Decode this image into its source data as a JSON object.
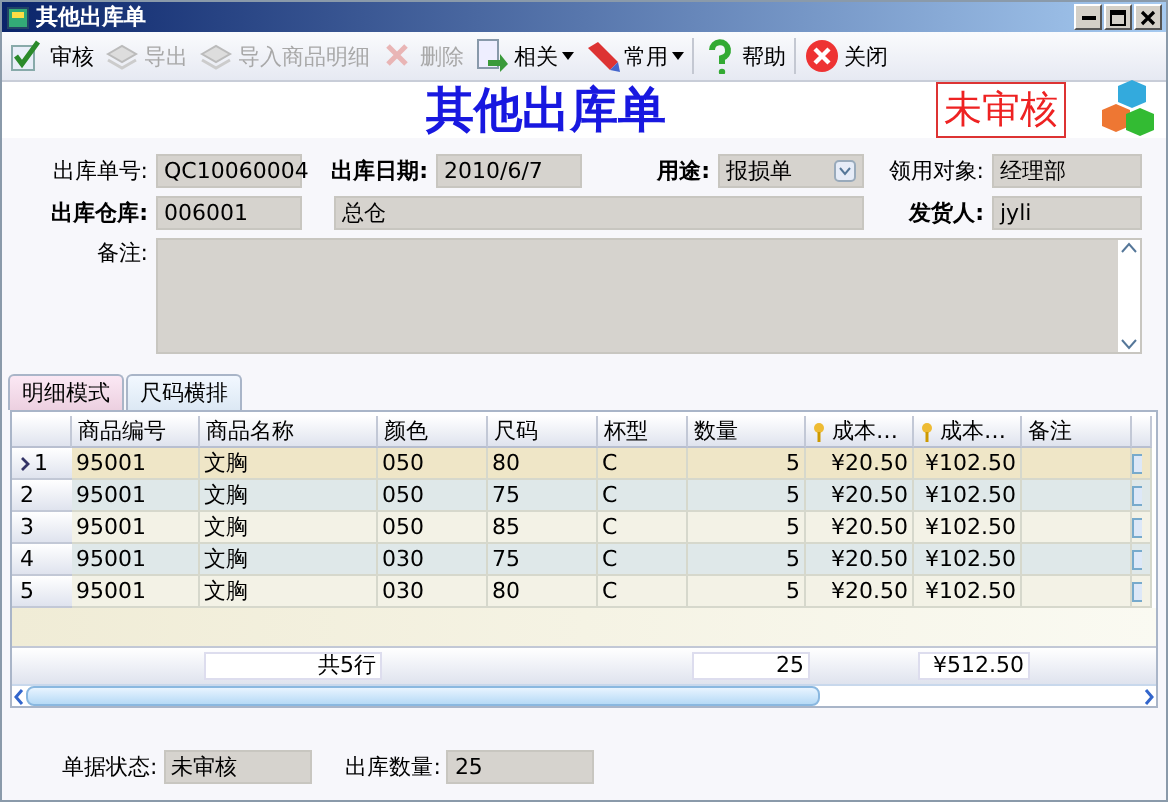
{
  "window": {
    "title": "其他出库单"
  },
  "toolbar": [
    {
      "label": "审核",
      "disabled": false,
      "dropdown": false
    },
    {
      "label": "导出",
      "disabled": true,
      "dropdown": false
    },
    {
      "label": "导入商品明细",
      "disabled": true,
      "dropdown": false
    },
    {
      "label": "删除",
      "disabled": true,
      "dropdown": false
    },
    {
      "label": "相关",
      "disabled": false,
      "dropdown": true
    },
    {
      "label": "常用",
      "disabled": false,
      "dropdown": true
    },
    {
      "label": "帮助",
      "disabled": false,
      "dropdown": false
    },
    {
      "label": "关闭",
      "disabled": false,
      "dropdown": false
    }
  ],
  "heading": "其他出库单",
  "status_stamp": "未审核",
  "form": [
    {
      "label": "出库单号:",
      "value": "QC10060004",
      "required": false
    },
    {
      "label": "出库日期:",
      "value": "2010/6/7",
      "required": true
    },
    {
      "label": "用途:",
      "value": "报损单",
      "required": true,
      "kind": "select"
    },
    {
      "label": "领用对象:",
      "value": "经理部",
      "required": false
    },
    {
      "label": "出库仓库:",
      "value": "006001",
      "required": true,
      "extra": "总仓"
    },
    {
      "label": "发货人:",
      "value": "jyli",
      "required": true
    }
  ],
  "notes": {
    "label": "备注:"
  },
  "tabs": [
    {
      "label": "明细模式",
      "selected": true
    },
    {
      "label": "尺码横排",
      "selected": false
    }
  ],
  "table": {
    "columns": [
      "商品编号",
      "商品名称",
      "颜色",
      "尺码",
      "杯型",
      "数量",
      "成本…",
      "成本…",
      "备注"
    ],
    "rows": [
      {
        "index": "1",
        "selected": true,
        "cells": [
          "95001",
          "文胸",
          "050",
          "80",
          "C",
          "5",
          "¥20.50",
          "¥102.50",
          ""
        ]
      },
      {
        "index": "2",
        "selected": false,
        "cells": [
          "95001",
          "文胸",
          "050",
          "75",
          "C",
          "5",
          "¥20.50",
          "¥102.50",
          ""
        ]
      },
      {
        "index": "3",
        "selected": false,
        "cells": [
          "95001",
          "文胸",
          "050",
          "85",
          "C",
          "5",
          "¥20.50",
          "¥102.50",
          ""
        ]
      },
      {
        "index": "4",
        "selected": false,
        "cells": [
          "95001",
          "文胸",
          "030",
          "75",
          "C",
          "5",
          "¥20.50",
          "¥102.50",
          ""
        ]
      },
      {
        "index": "5",
        "selected": false,
        "cells": [
          "95001",
          "文胸",
          "030",
          "80",
          "C",
          "5",
          "¥20.50",
          "¥102.50",
          ""
        ]
      }
    ],
    "footer": {
      "row_count": "共5行",
      "quantity": "25",
      "amount": "¥512.50"
    }
  },
  "summary": [
    {
      "label": "单据状态:",
      "value": "未审核"
    },
    {
      "label": "出库数量:",
      "value": "25"
    }
  ]
}
